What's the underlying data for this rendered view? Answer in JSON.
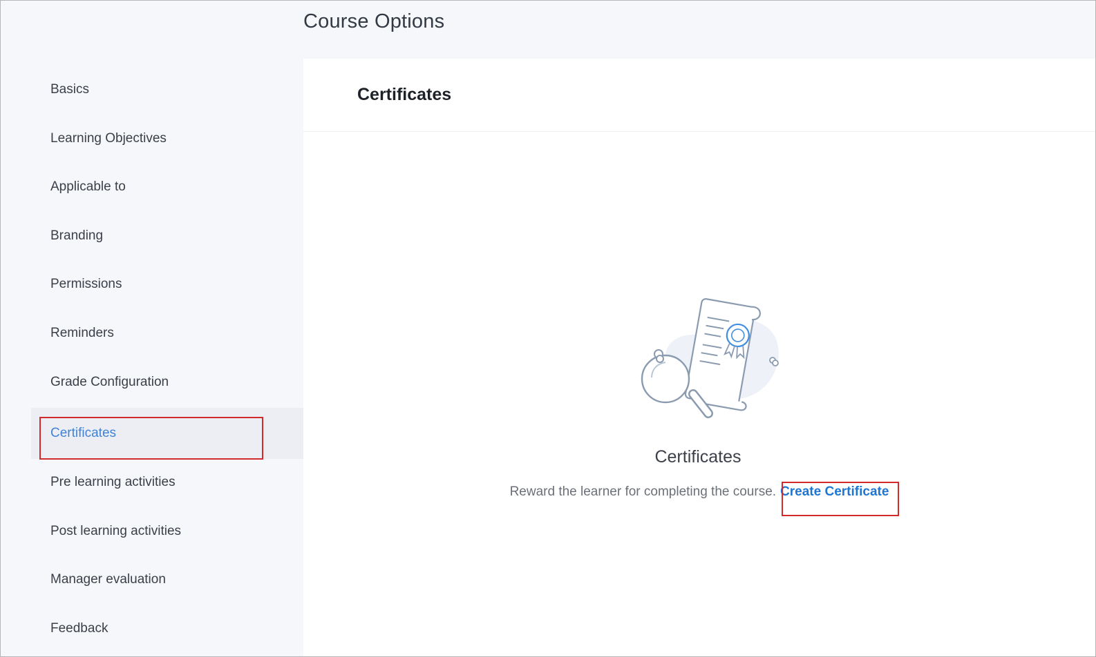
{
  "page": {
    "title": "Course Options"
  },
  "sidebar": {
    "items": [
      {
        "label": "Basics",
        "active": false
      },
      {
        "label": "Learning Objectives",
        "active": false
      },
      {
        "label": "Applicable to",
        "active": false
      },
      {
        "label": "Branding",
        "active": false
      },
      {
        "label": "Permissions",
        "active": false
      },
      {
        "label": "Reminders",
        "active": false
      },
      {
        "label": "Grade Configuration",
        "active": false
      },
      {
        "label": "Certificates",
        "active": true
      },
      {
        "label": "Pre learning activities",
        "active": false
      },
      {
        "label": "Post learning activities",
        "active": false
      },
      {
        "label": "Manager evaluation",
        "active": false
      },
      {
        "label": "Feedback",
        "active": false
      }
    ]
  },
  "main": {
    "header_title": "Certificates",
    "empty_state": {
      "illustration_icon": "certificate-magnifier-icon",
      "title": "Certificates",
      "description": "Reward the learner for completing the course.",
      "link_label": "Create Certificate"
    }
  },
  "colors": {
    "accent": "#1f76d2",
    "active_item": "#3f82d6",
    "highlight": "#d22a2a"
  }
}
